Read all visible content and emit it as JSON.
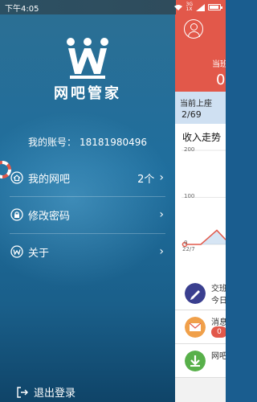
{
  "status_bar": {
    "time": "下午4:05",
    "network_label": "3G",
    "network_sub": "1X"
  },
  "drawer": {
    "app_title": "网吧管家",
    "account_label": "我的账号：",
    "account_number": "18181980496",
    "menu": [
      {
        "label": "我的网吧",
        "count": "2个",
        "icon": "home-icon"
      },
      {
        "label": "修改密码",
        "icon": "lock-icon"
      },
      {
        "label": "关于",
        "icon": "crown-icon"
      }
    ],
    "logout_label": "退出登录",
    "chevron": "›"
  },
  "main_peek": {
    "header_title": "当班",
    "header_value": "0",
    "online_title": "当前上座",
    "online_value": "2/69",
    "chart": {
      "title": "收入走势",
      "y_ticks": [
        "200",
        "100",
        "0"
      ],
      "x_first_label": "22/7"
    },
    "rows": [
      {
        "line1": "交班",
        "line2": "今日",
        "icon": "pen-icon"
      },
      {
        "line1": "消息",
        "badge": "0",
        "icon": "mail-icon"
      },
      {
        "line1": "网吧",
        "icon": "download-icon"
      }
    ]
  },
  "colors": {
    "accent": "#e2584a",
    "drawer_top": "#2b6f94",
    "drawer_bottom": "#0f4468",
    "online_bg": "#cfe0f2"
  },
  "chart_data": {
    "type": "line",
    "title": "收入走势",
    "xlabel": "",
    "ylabel": "",
    "ylim": [
      0,
      200
    ],
    "x": [
      "22/7"
    ],
    "values": [
      0
    ]
  }
}
